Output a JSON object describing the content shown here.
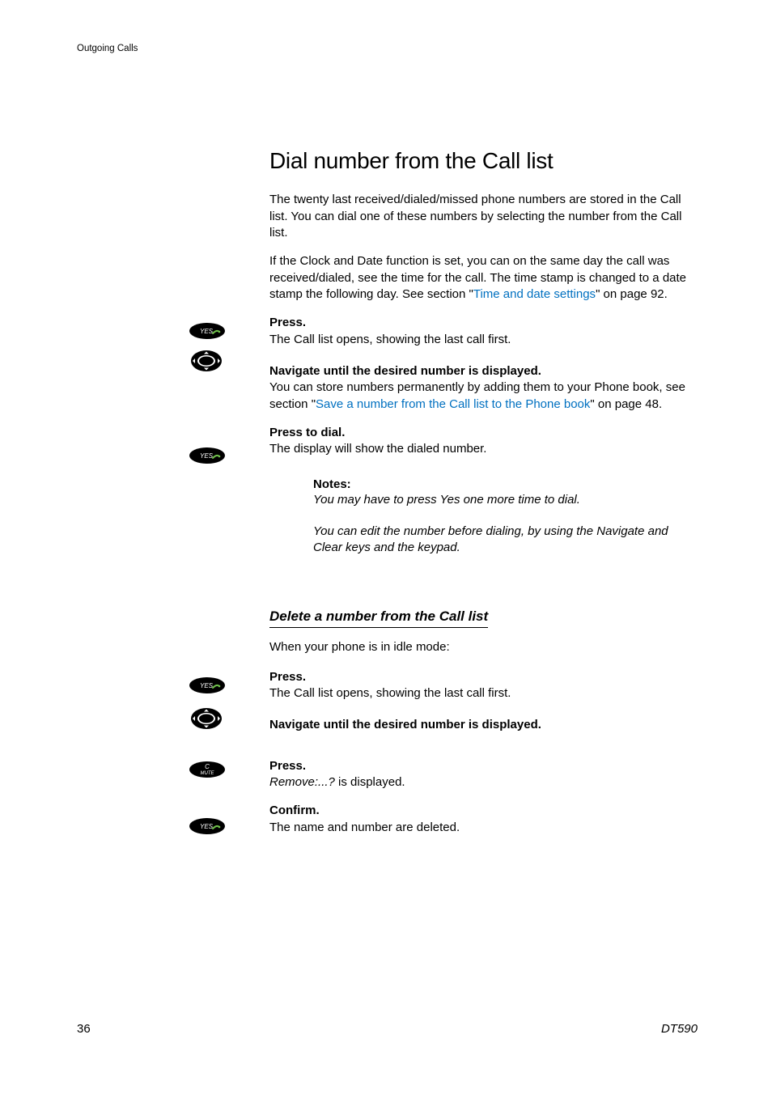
{
  "header": {
    "section": "Outgoing Calls"
  },
  "title": "Dial number from the Call list",
  "para1": "The twenty last received/dialed/missed phone numbers are stored in the Call list. You can dial one of these numbers by selecting the number from the Call list.",
  "para2_a": "If the Clock and Date function is set, you can on the same day the call was received/dialed, see the time for the call. The time stamp is changed to a date stamp the following day. See section \"",
  "para2_link": "Time and date settings",
  "para2_b": "\" on page 92.",
  "step1": {
    "title": "Press.",
    "body": "The Call list opens, showing the last call first."
  },
  "step2": {
    "title": "Navigate until the desired number is displayed.",
    "body_a": "You can store numbers permanently by adding them to your Phone book, see section \"",
    "body_link": "Save a number from the Call list to the Phone book",
    "body_b": "\" on page 48."
  },
  "step3": {
    "title": "Press to dial.",
    "body": "The display will show the dialed number."
  },
  "notes": {
    "title": "Notes:",
    "body1": "You may have to press Yes one more time to dial.",
    "body2": "You can edit the number before dialing, by using the Navigate and Clear keys and the keypad."
  },
  "subsection": {
    "title": "Delete a number from the Call list",
    "intro": "When your phone is in idle mode:",
    "step1": {
      "title": "Press.",
      "body": "The Call list opens, showing the last call first."
    },
    "step2": {
      "title": "Navigate until the desired number is displayed."
    },
    "step3": {
      "title": "Press.",
      "body_a": "Remove:...?",
      "body_b": " is displayed."
    },
    "step4": {
      "title": "Confirm.",
      "body": "The name and number are deleted."
    }
  },
  "footer": {
    "page": "36",
    "model": "DT590"
  },
  "icons": {
    "yes": "YES",
    "cmute_c": "C",
    "cmute_mute": "MUTE"
  }
}
